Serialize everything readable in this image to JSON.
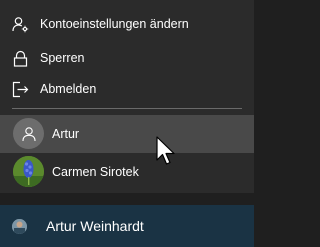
{
  "menu": {
    "items": [
      {
        "label": "Kontoeinstellungen ändern",
        "icon": "account-settings-icon"
      },
      {
        "label": "Sperren",
        "icon": "lock-icon"
      },
      {
        "label": "Abmelden",
        "icon": "sign-out-icon"
      }
    ]
  },
  "users": [
    {
      "name": "Artur",
      "avatar": "generic-user-avatar",
      "selected": true
    },
    {
      "name": "Carmen Sirotek",
      "avatar": "photo-avatar",
      "selected": false
    }
  ],
  "current_user": {
    "name": "Artur Weinhardt",
    "avatar": "photo-avatar"
  },
  "colors": {
    "menu_bg": "#2b2b2b",
    "selected_bg": "#494949",
    "taskbar_bg": "#1a3344",
    "text": "#ffffff"
  }
}
